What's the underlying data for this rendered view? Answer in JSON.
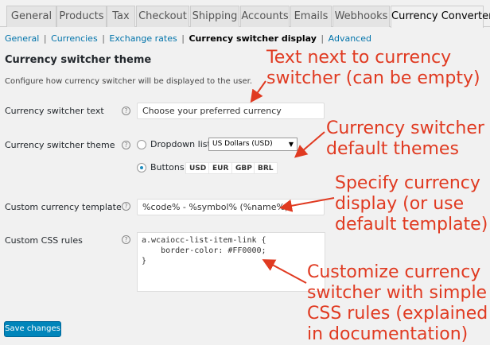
{
  "tabs": [
    "General",
    "Products",
    "Tax",
    "Checkout",
    "Shipping",
    "Accounts",
    "Emails",
    "Webhooks",
    "Currency Converter"
  ],
  "subnav": {
    "general": "General",
    "currencies": "Currencies",
    "exchange_rates": "Exchange rates",
    "current": "Currency switcher display",
    "advanced": "Advanced",
    "sep": "|"
  },
  "section": {
    "title": "Currency switcher theme",
    "description": "Configure how currency switcher will be displayed to the user."
  },
  "fields": {
    "switcher_text_label": "Currency switcher text",
    "switcher_text_value": "Choose your preferred currency",
    "switcher_theme_label": "Currency switcher theme",
    "dropdown_option_label": "Dropdown list",
    "dropdown_selected": "US Dollars (USD)",
    "buttons_option_label": "Buttons",
    "currency_buttons": [
      "USD",
      "EUR",
      "GBP",
      "BRL"
    ],
    "template_label": "Custom currency template",
    "template_value": "%code% - %symbol% (%name%)",
    "css_label": "Custom CSS rules",
    "css_value": "a.wcaiocc-list-item-link {\n    border-color: #FF0000;\n}"
  },
  "save_button": "Save changes",
  "help_glyph": "?",
  "annotations": {
    "a1": [
      "Text next to currency",
      "switcher (can be empty)"
    ],
    "a2": [
      "Currency switcher",
      "default themes"
    ],
    "a3": [
      "Specify currency",
      "display (or use",
      "default template)"
    ],
    "a4": [
      "Customize currency",
      "switcher with simple",
      "CSS rules (explained",
      "in documentation)"
    ]
  },
  "colors": {
    "accent": "#0085ba",
    "annotation": "#e03a21",
    "link": "#0073aa"
  }
}
